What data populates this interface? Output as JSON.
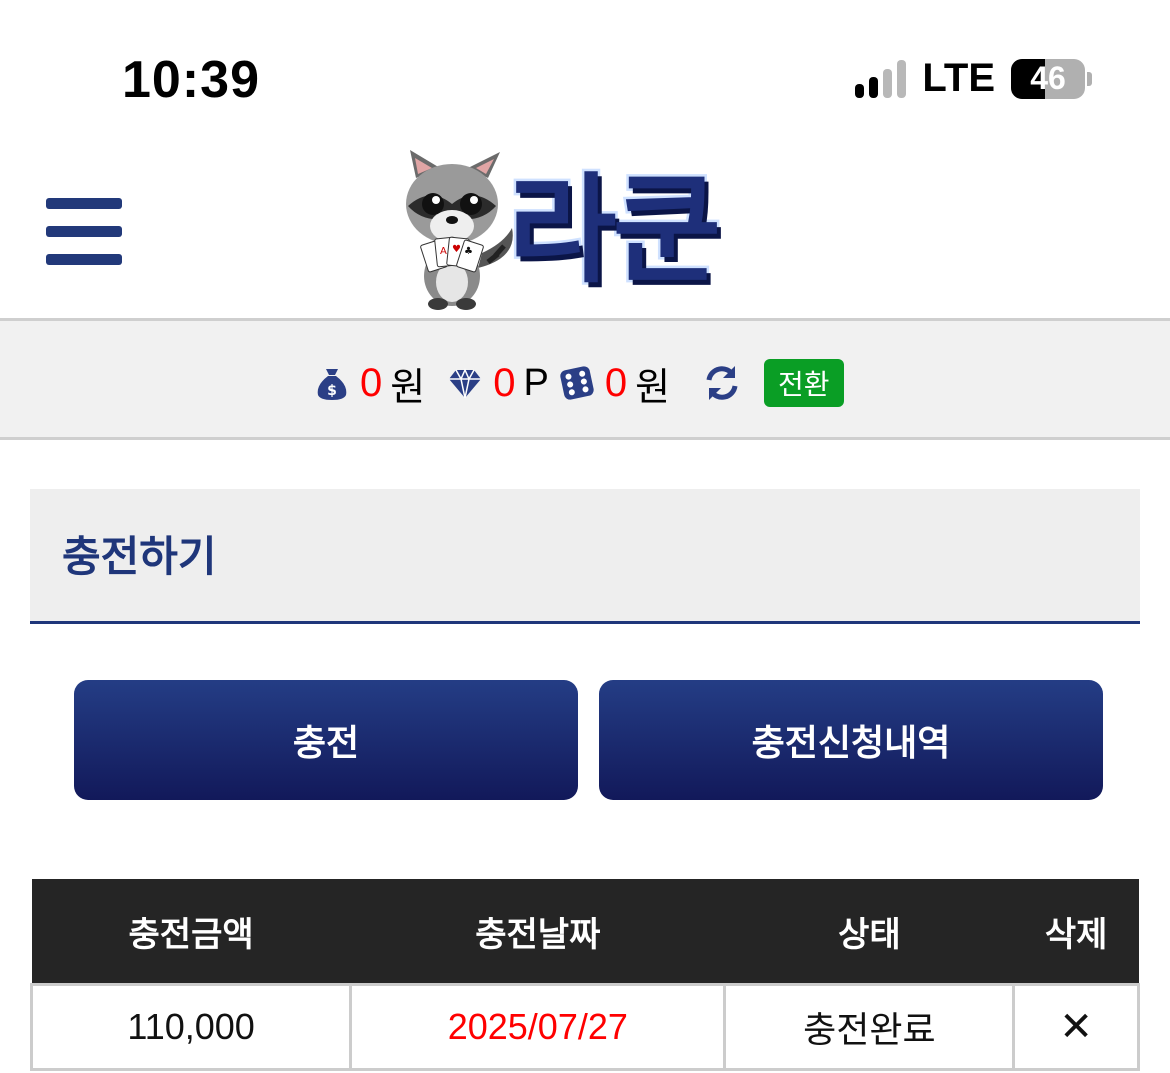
{
  "status_bar": {
    "time": "10:39",
    "network": "LTE",
    "battery": "46",
    "battery_level": 0.46
  },
  "header": {
    "logo_text": "라쿤",
    "menu_icon": "hamburger-menu-icon"
  },
  "balance": {
    "money_value": "0",
    "money_unit": "원",
    "point_value": "0",
    "point_unit": "P",
    "casino_value": "0",
    "casino_unit": "원",
    "switch_label": "전환",
    "value_color": "#ff0000"
  },
  "section": {
    "title": "충전하기"
  },
  "tabs": [
    {
      "label": "충전"
    },
    {
      "label": "충전신청내역"
    }
  ],
  "table": {
    "headers": [
      "충전금액",
      "충전날짜",
      "상태",
      "삭제"
    ],
    "rows": [
      {
        "amount": "110,000",
        "date": "2025/07/27",
        "status": "충전완료",
        "delete": "✕"
      }
    ]
  },
  "colors": {
    "brand_navy": "#1f367a",
    "switch_green": "#0a9e25",
    "date_red": "#ff0000",
    "table_header": "#252525"
  }
}
